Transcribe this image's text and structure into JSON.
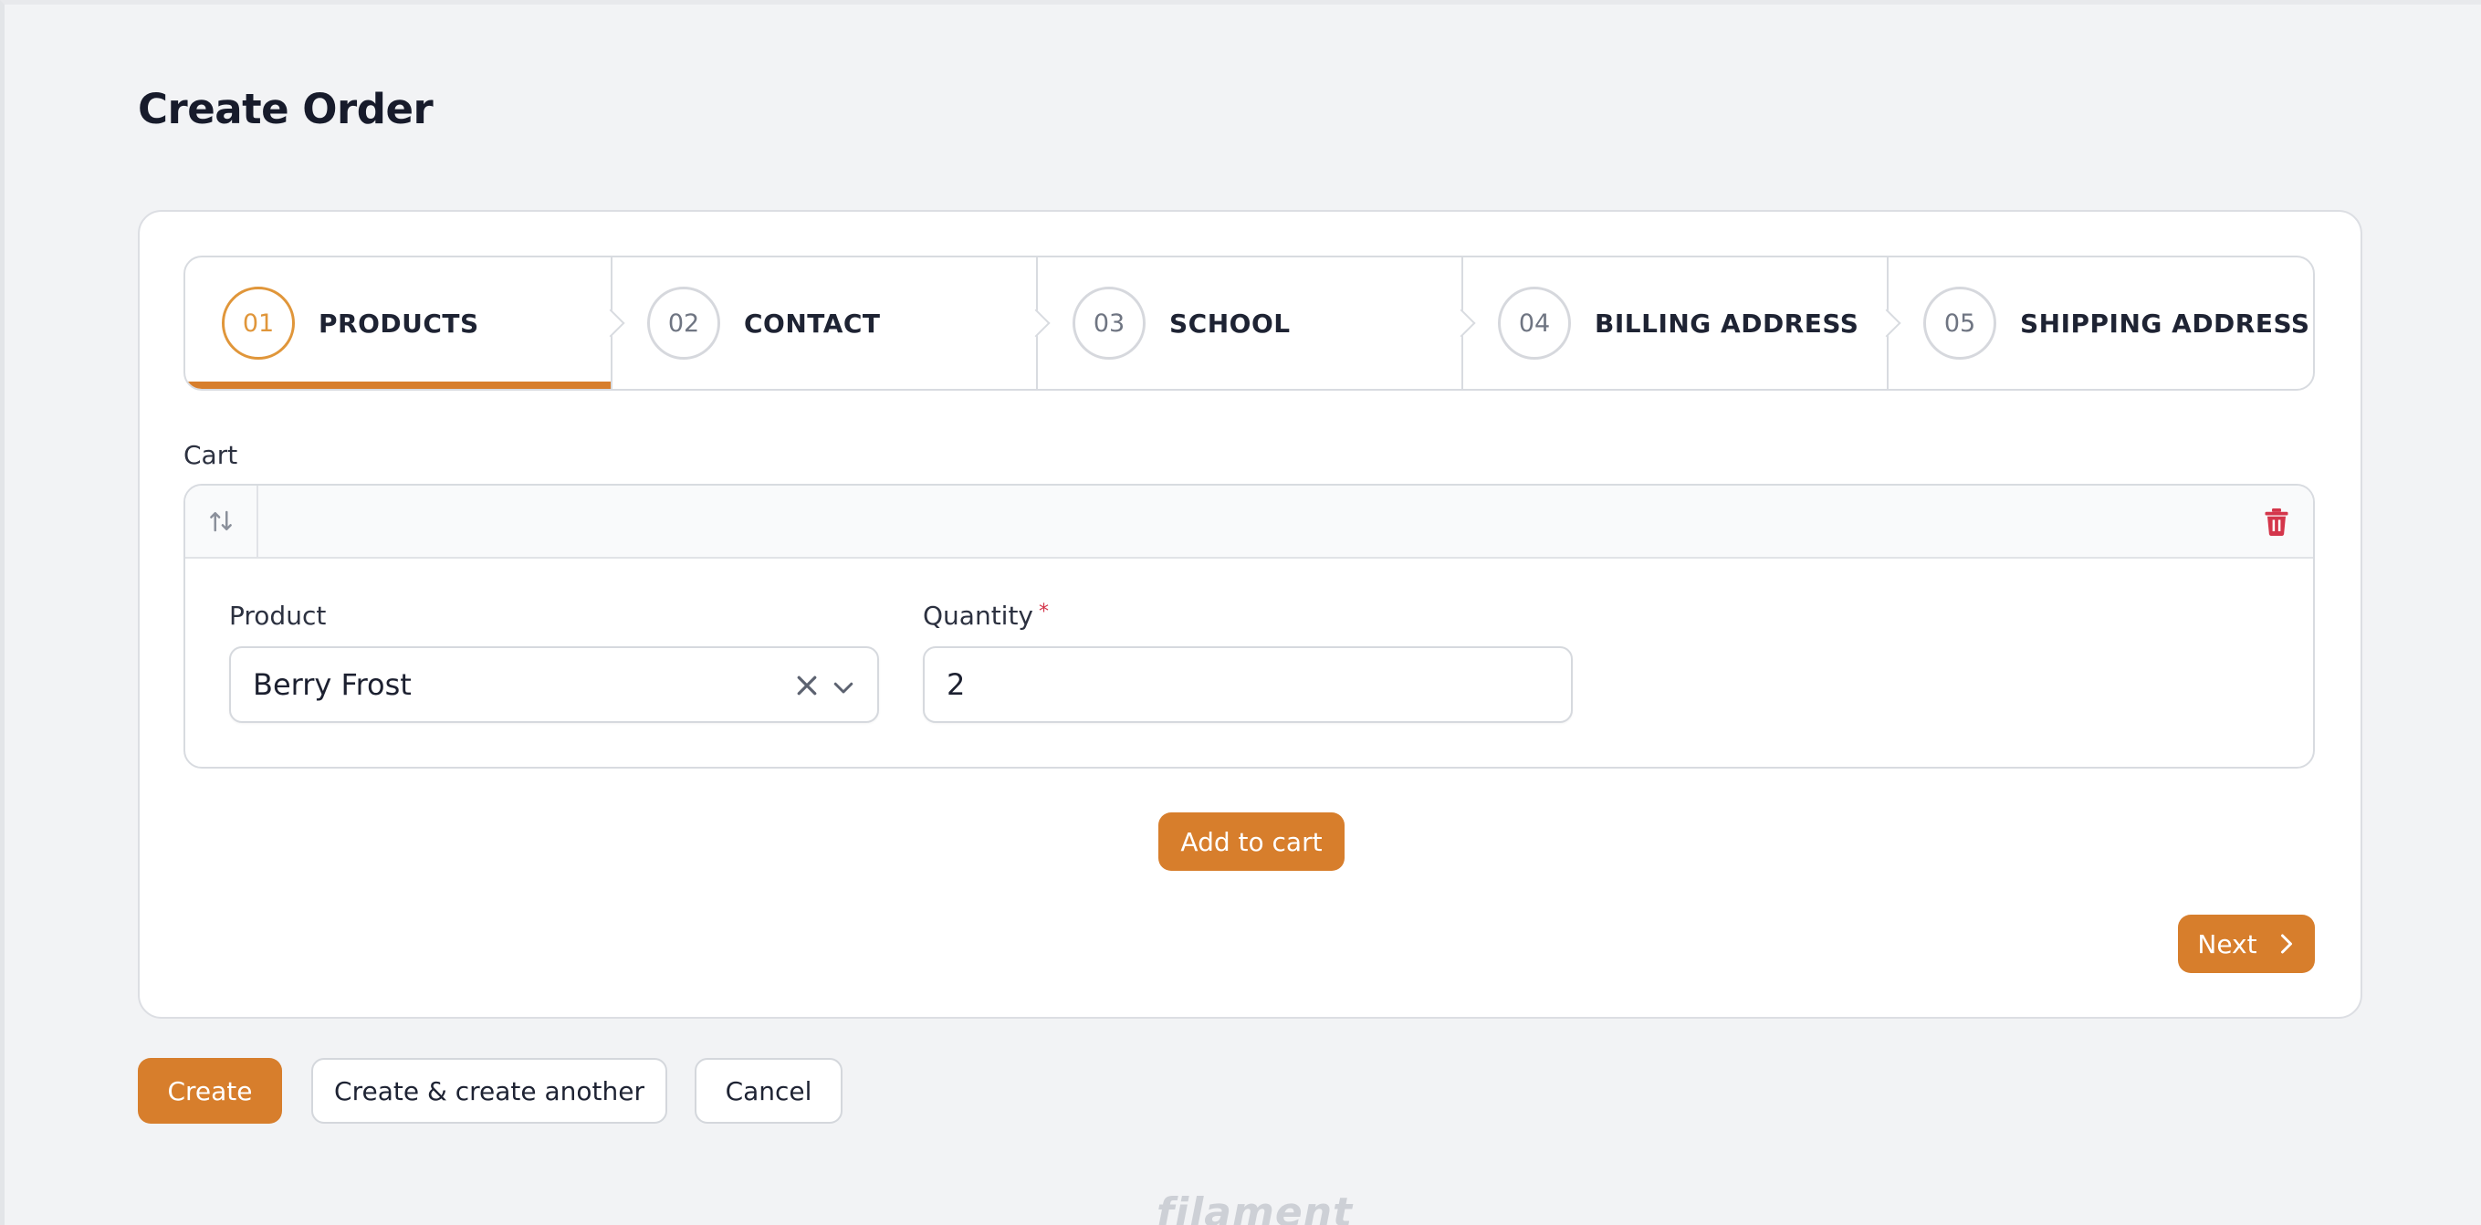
{
  "page": {
    "title": "Create Order"
  },
  "wizard": {
    "steps": [
      {
        "number": "01",
        "label": "PRODUCTS",
        "active": true
      },
      {
        "number": "02",
        "label": "CONTACT",
        "active": false
      },
      {
        "number": "03",
        "label": "SCHOOL",
        "active": false
      },
      {
        "number": "04",
        "label": "BILLING ADDRESS",
        "active": false
      },
      {
        "number": "05",
        "label": "SHIPPING ADDRESS",
        "active": false
      }
    ]
  },
  "cart": {
    "label": "Cart",
    "item": {
      "product_label": "Product",
      "product_value": "Berry Frost",
      "quantity_label": "Quantity",
      "quantity_required_mark": "*",
      "quantity_value": "2"
    },
    "add_button": "Add to cart"
  },
  "navigation": {
    "next_label": "Next"
  },
  "actions": {
    "create": "Create",
    "create_another": "Create & create another",
    "cancel": "Cancel"
  },
  "footer": {
    "brand": "filament"
  },
  "icons": {
    "reorder": "arrows-up-down-icon",
    "delete": "trash-icon",
    "clear": "x-mark-icon",
    "dropdown": "chevron-down-icon",
    "next": "chevron-right-icon"
  },
  "colors": {
    "primary": "#d77e2c",
    "active_step": "#e0963a",
    "danger": "#d4364b",
    "background": "#f2f3f5"
  }
}
